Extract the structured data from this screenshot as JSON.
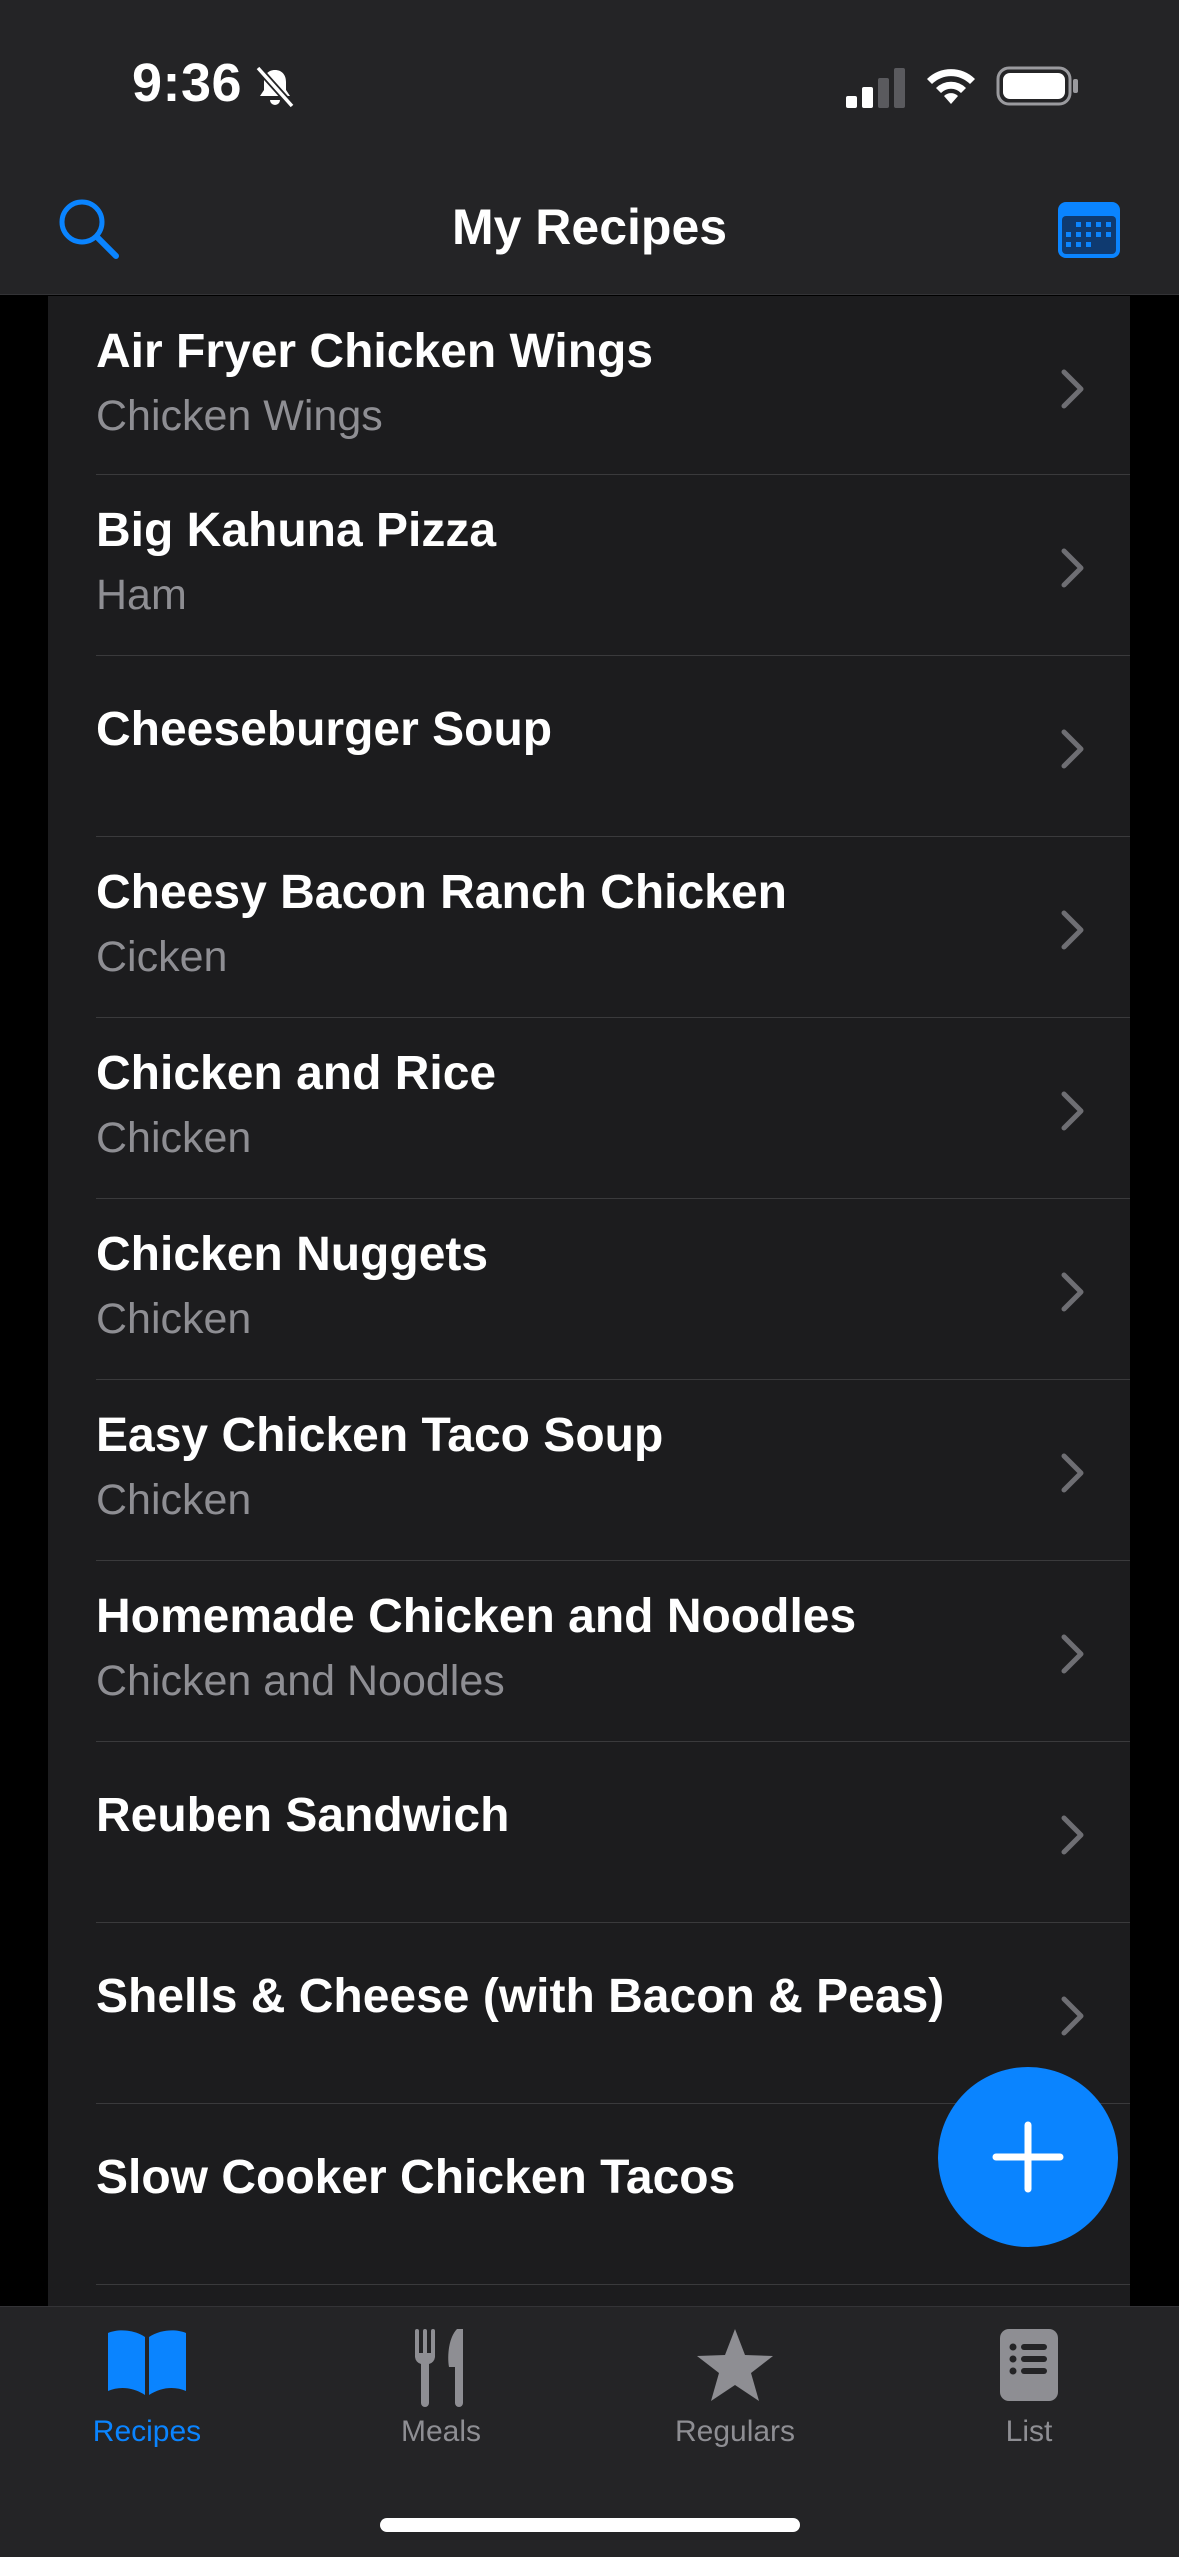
{
  "status": {
    "time": "9:36"
  },
  "nav": {
    "title": "My Recipes"
  },
  "recipes": [
    {
      "title": "Air Fryer Chicken Wings",
      "subtitle": "Chicken Wings"
    },
    {
      "title": "Big Kahuna Pizza",
      "subtitle": "Ham"
    },
    {
      "title": "Cheeseburger Soup",
      "subtitle": ""
    },
    {
      "title": "Cheesy Bacon Ranch Chicken",
      "subtitle": "Cicken"
    },
    {
      "title": "Chicken and Rice",
      "subtitle": "Chicken"
    },
    {
      "title": "Chicken Nuggets",
      "subtitle": "Chicken"
    },
    {
      "title": "Easy Chicken Taco Soup",
      "subtitle": "Chicken"
    },
    {
      "title": "Homemade Chicken and Noodles",
      "subtitle": "Chicken and Noodles"
    },
    {
      "title": "Reuben Sandwich",
      "subtitle": ""
    },
    {
      "title": "Shells & Cheese (with Bacon & Peas)",
      "subtitle": ""
    },
    {
      "title": "Slow Cooker Chicken Tacos",
      "subtitle": ""
    }
  ],
  "tabs": [
    {
      "label": "Recipes",
      "icon": "book-icon",
      "active": true
    },
    {
      "label": "Meals",
      "icon": "fork-knife-icon",
      "active": false
    },
    {
      "label": "Regulars",
      "icon": "star-icon",
      "active": false
    },
    {
      "label": "List",
      "icon": "list-icon",
      "active": false
    }
  ],
  "colors": {
    "accent": "#0a84ff",
    "background": "#1c1c1e",
    "bar": "#242426",
    "secondary_text": "#8e8e93"
  }
}
